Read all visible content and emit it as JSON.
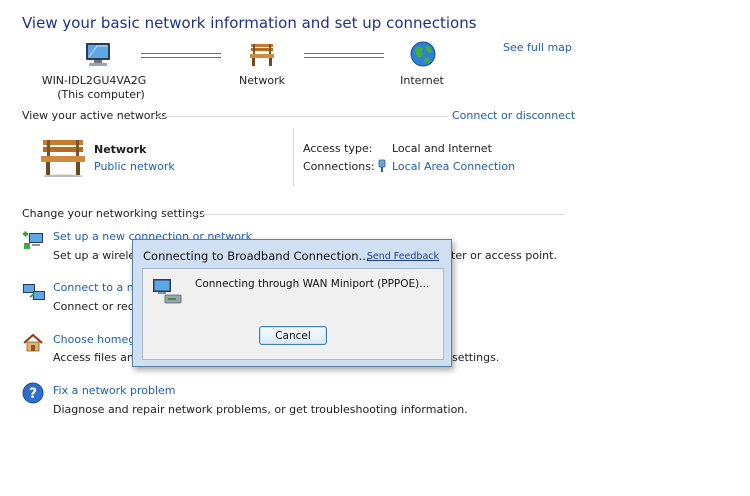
{
  "page": {
    "title": "View your basic network information and set up connections",
    "see_full_map": "See full map"
  },
  "network_map": {
    "computer_name": "WIN-IDL2GU4VA2G",
    "computer_sub": "(This computer)",
    "network_label": "Network",
    "internet_label": "Internet"
  },
  "active_networks": {
    "header": "View your active networks",
    "connect_link": "Connect or disconnect",
    "network_name": "Network",
    "network_type": "Public network",
    "access_type_label": "Access type:",
    "access_type_value": "Local and Internet",
    "connections_label": "Connections:",
    "connections_value": "Local Area Connection"
  },
  "settings": {
    "header": "Change your networking settings",
    "tasks": [
      {
        "title": "Set up a new connection or network",
        "desc": "Set up a wireless, broadband, dial-up, ad hoc, or VPN connection; or set up a router or access point."
      },
      {
        "title": "Connect to a network",
        "desc": "Connect or reconnect to a wireless, wired, dial-up, or VPN network connection."
      },
      {
        "title": "Choose homegroup and sharing options",
        "desc": "Access files and printers located on other network computers, or change sharing settings."
      },
      {
        "title": "Fix a network problem",
        "desc": "Diagnose and repair network problems, or get troubleshooting information."
      }
    ],
    "visible_fragments": {
      "t0_title": "Set up a new connection or network",
      "t0_desc_left": "Set up a wireless",
      "t0_desc_right": "ter or access point.",
      "t1_title": "Connect to a ne",
      "t1_desc": "Connect or reco",
      "t2_title": "Choose homegr",
      "t2_desc_left": "Access files and",
      "t2_desc_right": "settings.",
      "t3_title": "Fix a network problem",
      "t3_desc": "Diagnose and repair network problems, or get troubleshooting information."
    }
  },
  "dialog": {
    "title": "Connecting to Broadband Connection...",
    "feedback": "Send Feedback",
    "message": "Connecting through WAN Miniport (PPPOE)...",
    "cancel": "Cancel"
  },
  "colors": {
    "title_blue": "#1e3287",
    "link_blue": "#1f5fa8",
    "map_green": "#3b8f3b",
    "dialog_frame": "#cfe0f2"
  }
}
